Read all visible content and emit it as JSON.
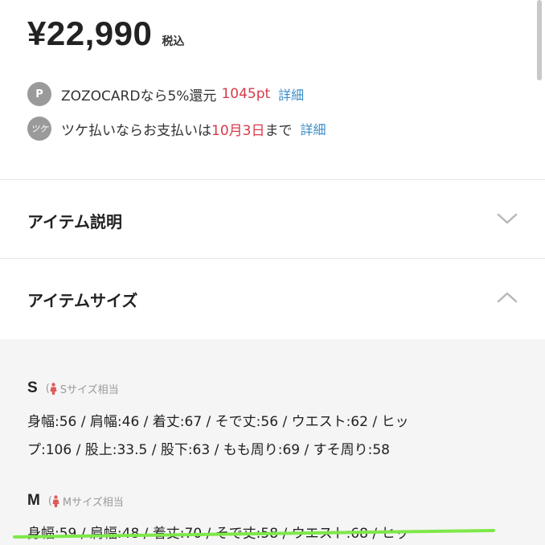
{
  "price": {
    "amount": "¥22,990",
    "tax_label": "税込"
  },
  "zozocard": {
    "icon_text": "P",
    "prefix": "ZOZOCARDなら5%還元",
    "points": "1045pt",
    "link": "詳細"
  },
  "tsuke": {
    "icon_text": "ツケ",
    "prefix": "ツケ払いならお支払いは",
    "date": "10月3日",
    "suffix": "まで",
    "link": "詳細"
  },
  "sections": {
    "description": {
      "title": "アイテム説明",
      "state": "collapsed"
    },
    "size": {
      "title": "アイテムサイズ",
      "state": "expanded"
    }
  },
  "sizes": [
    {
      "label": "S",
      "note": "Sサイズ相当",
      "line1": "身幅:56 / 肩幅:46 / 着丈:67 / そで丈:56 / ウエスト:62 / ヒッ",
      "line2": "プ:106 / 股上:33.5 / 股下:63 / もも周り:69 / すそ周り:58"
    },
    {
      "label": "M",
      "note": "Mサイズ相当",
      "line1": "身幅:59 / 肩幅:48 / 着丈:70 / そで丈:58 / ウエスト:68 / ヒッ"
    }
  ],
  "colors": {
    "accent_red": "#d73a4b",
    "link_blue": "#3a8dc9",
    "highlight_green": "#7ee84a",
    "person_icon_red": "#e05a5a",
    "size_panel_bg": "#f5f5f5"
  },
  "icons": {
    "points": "p-circle-icon",
    "tsuke": "tsuke-circle-icon",
    "collapsed": "chevron-down-icon",
    "expanded": "chevron-up-icon",
    "size_reference": "person-icon"
  }
}
